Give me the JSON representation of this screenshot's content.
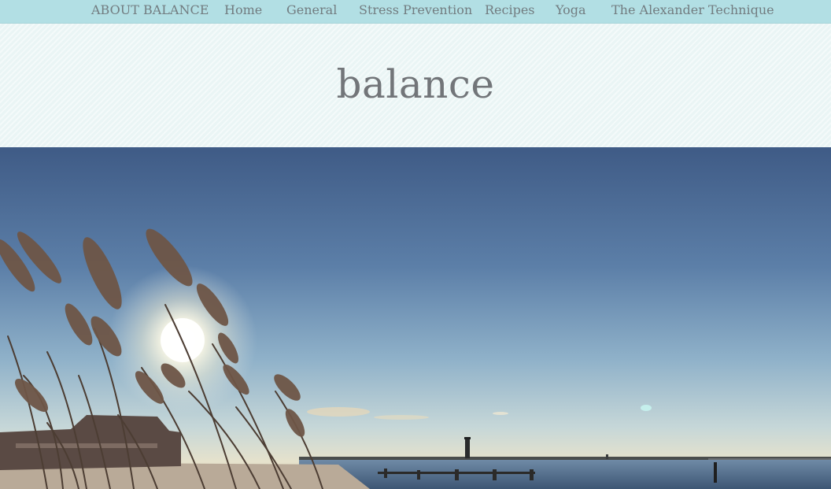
{
  "nav": {
    "items": [
      {
        "label": "ABOUT BALANCE"
      },
      {
        "label": "Home"
      },
      {
        "label": "General"
      },
      {
        "label": "Stress Prevention"
      },
      {
        "label": "Recipes"
      },
      {
        "label": "Yoga"
      },
      {
        "label": "The Alexander Technique"
      }
    ]
  },
  "header": {
    "title": "balance"
  },
  "colors": {
    "nav_bg": "#b2dfe4",
    "nav_text": "#727c80",
    "header_bg": "#eef7f7",
    "title_text": "#727579"
  }
}
